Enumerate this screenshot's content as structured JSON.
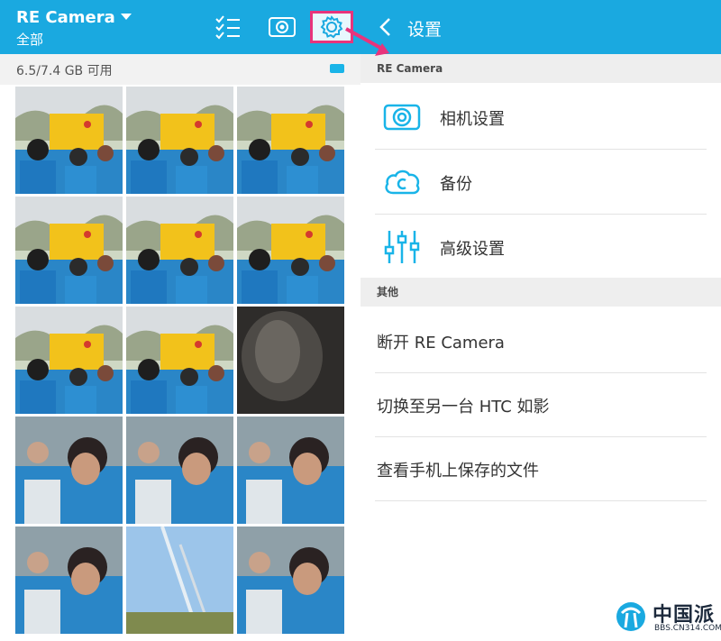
{
  "left": {
    "app_title": "RE Camera",
    "filter": "全部",
    "storage": "6.5/7.4 GB 可用",
    "toolbar_icons": [
      "checklist-icon",
      "camera-icon",
      "gear-icon"
    ],
    "photos": [
      "crowd-banner",
      "crowd-banner",
      "crowd-banner",
      "crowd-banner",
      "crowd-banner",
      "crowd-banner",
      "crowd-banner",
      "crowd-banner",
      "dark-texture",
      "people-closeup",
      "people-closeup",
      "people-closeup",
      "people-closeup",
      "sky-pole",
      "people-closeup"
    ]
  },
  "right": {
    "title": "设置",
    "section_recamera": "RE Camera",
    "items_recamera": [
      {
        "icon": "camera-icon",
        "label": "相机设置"
      },
      {
        "icon": "cloud-icon",
        "label": "备份"
      },
      {
        "icon": "sliders-icon",
        "label": "高级设置"
      }
    ],
    "section_other": "其他",
    "items_other": [
      {
        "label": "断开 RE Camera"
      },
      {
        "label": "切换至另一台 HTC 如影"
      },
      {
        "label": "查看手机上保存的文件"
      }
    ]
  },
  "watermark": {
    "name": "中国派",
    "url": "BBS.CN314.COM"
  },
  "colors": {
    "accent": "#1aa9e0",
    "highlight": "#e8347c",
    "icon_teal": "#19b4e8"
  }
}
